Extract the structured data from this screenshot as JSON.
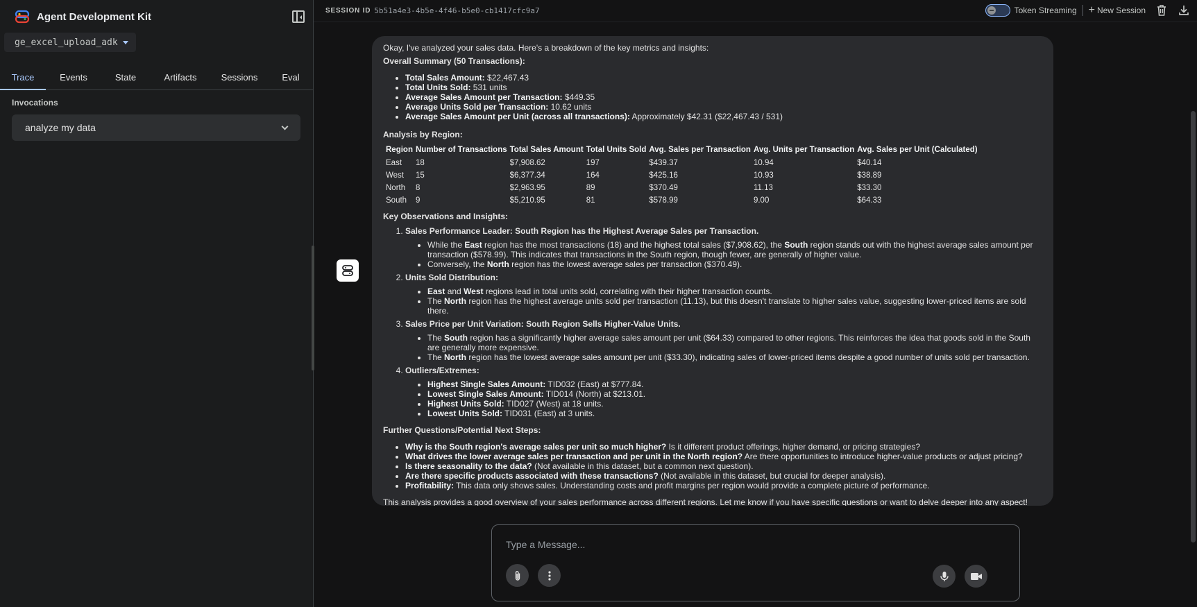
{
  "sidebar": {
    "app_title": "Agent Development Kit",
    "app_name": "ge_excel_upload_adk",
    "tabs": [
      {
        "label": "Trace"
      },
      {
        "label": "Events"
      },
      {
        "label": "State"
      },
      {
        "label": "Artifacts"
      },
      {
        "label": "Sessions"
      },
      {
        "label": "Eval"
      }
    ],
    "active_tab": "Trace",
    "invocations_label": "Invocations",
    "invocation_item": "analyze my data"
  },
  "header": {
    "session_label": "SESSION ID",
    "session_id": "5b51a4e3-4b5e-4f46-b5e0-cb1417cfc9a7",
    "token_streaming_label": "Token Streaming",
    "token_streaming_on": false,
    "new_session_label": "New Session"
  },
  "message": {
    "intro": "Okay, I've analyzed your sales data. Here's a breakdown of the key metrics and insights:",
    "overall_heading": "Overall Summary (50 Transactions):",
    "overall": [
      {
        "k": "Total Sales Amount:",
        "v": " $22,467.43"
      },
      {
        "k": "Total Units Sold:",
        "v": " 531 units"
      },
      {
        "k": "Average Sales Amount per Transaction:",
        "v": " $449.35"
      },
      {
        "k": "Average Units Sold per Transaction:",
        "v": " 10.62 units"
      },
      {
        "k": "Average Sales Amount per Unit (across all transactions):",
        "v": " Approximately $42.31 ($22,467.43 / 531)"
      }
    ],
    "region_heading": "Analysis by Region:",
    "table": {
      "headers": [
        "Region",
        "Number of Transactions",
        "Total Sales Amount",
        "Total Units Sold",
        "Avg. Sales per Transaction",
        "Avg. Units per Transaction",
        "Avg. Sales per Unit (Calculated)"
      ],
      "rows": [
        [
          "East",
          "18",
          "$7,908.62",
          "197",
          "$439.37",
          "10.94",
          "$40.14"
        ],
        [
          "West",
          "15",
          "$6,377.34",
          "164",
          "$425.16",
          "10.93",
          "$38.89"
        ],
        [
          "North",
          "8",
          "$2,963.95",
          "89",
          "$370.49",
          "11.13",
          "$33.30"
        ],
        [
          "South",
          "9",
          "$5,210.95",
          "81",
          "$578.99",
          "9.00",
          "$64.33"
        ]
      ]
    },
    "obs_heading": "Key Observations and Insights:",
    "observations": [
      {
        "title": "Sales Performance Leader: South Region has the Highest Average Sales per Transaction.",
        "points": [
          [
            "While the ",
            "East",
            " region has the most transactions (18) and the highest total sales ($7,908.62), the ",
            "South",
            " region stands out with the highest average sales amount per transaction ($578.99). This indicates that transactions in the South region, though fewer, are generally of higher value."
          ],
          [
            "Conversely, the ",
            "North",
            " region has the lowest average sales per transaction ($370.49)."
          ]
        ]
      },
      {
        "title": "Units Sold Distribution:",
        "points": [
          [
            "",
            "East",
            " and ",
            "West",
            " regions lead in total units sold, correlating with their higher transaction counts."
          ],
          [
            "The ",
            "North",
            " region has the highest average units sold per transaction (11.13), but this doesn't translate to higher sales value, suggesting lower-priced items are sold there."
          ]
        ]
      },
      {
        "title": "Sales Price per Unit Variation: South Region Sells Higher-Value Units.",
        "points": [
          [
            "The ",
            "South",
            " region has a significantly higher average sales amount per unit ($64.33) compared to other regions. This reinforces the idea that goods sold in the South are generally more expensive."
          ],
          [
            "The ",
            "North",
            " region has the lowest average sales amount per unit ($33.30), indicating sales of lower-priced items despite a good number of units sold per transaction."
          ]
        ]
      },
      {
        "title": "Outliers/Extremes:",
        "points": [
          [
            "",
            "Highest Single Sales Amount:",
            " TID032 (East) at $777.84."
          ],
          [
            "",
            "Lowest Single Sales Amount:",
            " TID014 (North) at $213.01."
          ],
          [
            "",
            "Highest Units Sold:",
            " TID027 (West) at 18 units."
          ],
          [
            "",
            "Lowest Units Sold:",
            " TID031 (East) at 3 units."
          ]
        ]
      }
    ],
    "next_heading": "Further Questions/Potential Next Steps:",
    "next_steps": [
      {
        "k": "Why is the South region's average sales per unit so much higher?",
        "v": " Is it different product offerings, higher demand, or pricing strategies?"
      },
      {
        "k": "What drives the lower average sales per transaction and per unit in the North region?",
        "v": " Are there opportunities to introduce higher-value products or adjust pricing?"
      },
      {
        "k": "Is there seasonality to the data?",
        "v": " (Not available in this dataset, but a common next question)."
      },
      {
        "k": "Are there specific products associated with these transactions?",
        "v": " (Not available in this dataset, but crucial for deeper analysis)."
      },
      {
        "k": "Profitability:",
        "v": " This data only shows sales. Understanding costs and profit margins per region would provide a complete picture of performance."
      }
    ],
    "closing": "This analysis provides a good overview of your sales performance across different regions. Let me know if you have specific questions or want to delve deeper into any aspect!"
  },
  "composer": {
    "placeholder": "Type a Message..."
  },
  "icons": {
    "logo": "adk-logo-icon",
    "collapse": "sidebar-collapse-icon",
    "bot": "bot-avatar-icon",
    "trash": "trash-icon",
    "download": "download-icon",
    "attach": "paperclip-icon",
    "more": "more-vert-icon",
    "mic": "mic-icon",
    "video": "videocam-icon"
  },
  "colors": {
    "accent": "#a8c7fa",
    "background": "#131314",
    "sidebar": "#1b1c1d",
    "bubble": "#2a2b2e"
  }
}
